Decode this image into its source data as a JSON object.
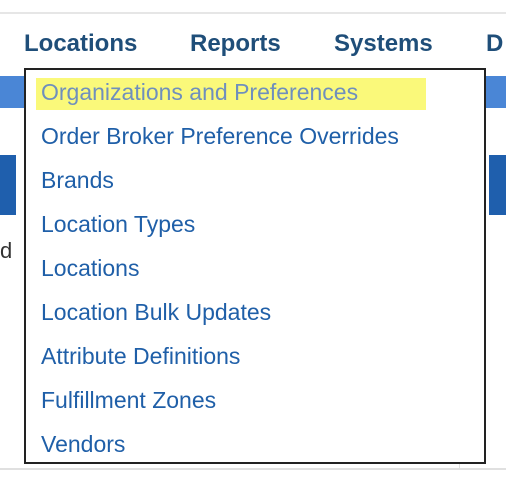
{
  "menu_bar": {
    "items": [
      {
        "label": "Locations"
      },
      {
        "label": "Reports"
      },
      {
        "label": "Systems"
      },
      {
        "label": "D"
      }
    ]
  },
  "background_fragment": "d",
  "dropdown": {
    "items": [
      {
        "label": "Organizations and Preferences",
        "highlighted": true
      },
      {
        "label": "Order Broker Preference Overrides"
      },
      {
        "label": "Brands"
      },
      {
        "label": "Location Types"
      },
      {
        "label": "Locations"
      },
      {
        "label": "Location Bulk Updates"
      },
      {
        "label": "Attribute Definitions"
      },
      {
        "label": "Fulfillment Zones"
      },
      {
        "label": "Vendors"
      }
    ]
  },
  "colors": {
    "menu_text": "#1f4e79",
    "dropdown_text": "#1f5fa8",
    "highlight": "#faf97a",
    "header_band": "#4a86d6"
  }
}
